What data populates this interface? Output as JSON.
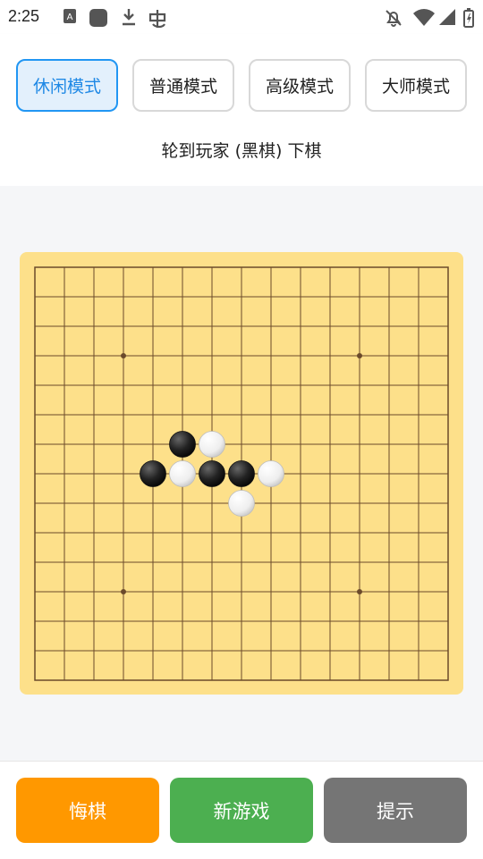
{
  "status_bar": {
    "time": "2:25"
  },
  "modes": [
    {
      "label": "休闲模式",
      "active": true
    },
    {
      "label": "普通模式",
      "active": false
    },
    {
      "label": "高级模式",
      "active": false
    },
    {
      "label": "大师模式",
      "active": false
    }
  ],
  "turn_text": "轮到玩家 (黑棋) 下棋",
  "board": {
    "size": 15,
    "star_points": [
      [
        3,
        3
      ],
      [
        3,
        11
      ],
      [
        11,
        3
      ],
      [
        11,
        11
      ]
    ],
    "stones": [
      {
        "col": 5,
        "row": 6,
        "color": "black"
      },
      {
        "col": 6,
        "row": 6,
        "color": "white"
      },
      {
        "col": 4,
        "row": 7,
        "color": "black"
      },
      {
        "col": 5,
        "row": 7,
        "color": "white"
      },
      {
        "col": 6,
        "row": 7,
        "color": "black"
      },
      {
        "col": 7,
        "row": 7,
        "color": "black"
      },
      {
        "col": 8,
        "row": 7,
        "color": "white"
      },
      {
        "col": 7,
        "row": 8,
        "color": "white"
      }
    ]
  },
  "actions": [
    {
      "label": "悔棋",
      "color": "#FF9800"
    },
    {
      "label": "新游戏",
      "color": "#4CAF50"
    },
    {
      "label": "提示",
      "color": "#757575"
    }
  ],
  "colors": {
    "accent": "#2196F3",
    "board": "#FDE08A",
    "grid": "#6b4a2b"
  }
}
